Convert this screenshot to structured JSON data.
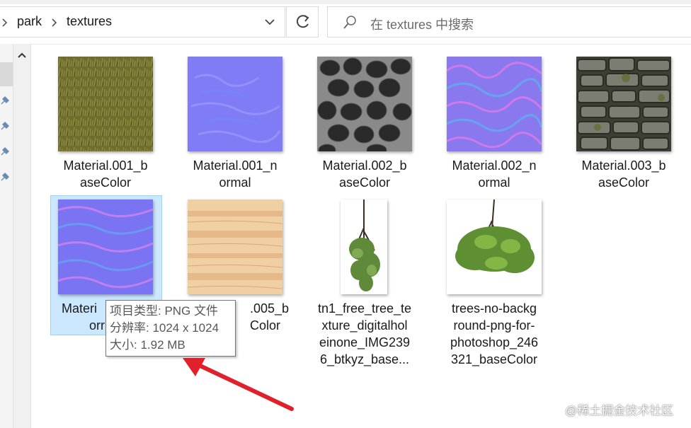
{
  "breadcrumb": [
    "park",
    "textures"
  ],
  "search": {
    "placeholder": "在 textures 中搜索"
  },
  "files": [
    {
      "name": "Material.001_baseColor",
      "lines": [
        "Material.001_b",
        "aseColor"
      ]
    },
    {
      "name": "Material.001_normal",
      "lines": [
        "Material.001_n",
        "ormal"
      ]
    },
    {
      "name": "Material.002_baseColor",
      "lines": [
        "Material.002_b",
        "aseColor"
      ]
    },
    {
      "name": "Material.002_normal",
      "lines": [
        "Material.002_n",
        "ormal"
      ]
    },
    {
      "name": "Material.003_baseColor",
      "lines": [
        "Material.003_b",
        "aseColor"
      ]
    },
    {
      "name": "Material.004_normal",
      "lines": [
        "Materi",
        "orr"
      ]
    },
    {
      "name": "Material.005_baseColor",
      "lines": [
        ".005_b",
        "Color"
      ]
    },
    {
      "name": "tn1_free_tree_texture_digitalholeinone_IMG2396_btkyz_baseColor",
      "lines": [
        "tn1_free_tree_te",
        "xture_digitalhol",
        "einone_IMG239",
        "6_btkyz_base..."
      ]
    },
    {
      "name": "trees-no-background-png-for-photoshop_246321_baseColor",
      "lines": [
        "trees-no-backg",
        "round-png-for-",
        "photoshop_246",
        "321_baseColor"
      ]
    }
  ],
  "tooltip": {
    "type": "项目类型: PNG 文件",
    "resolution": "分辨率: 1024 x 1024",
    "size": "大小: 1.92 MB"
  },
  "watermark": "@稀土掘金技术社区",
  "colors": {
    "selection": "#cce8ff",
    "arrow": "#e0202a"
  },
  "icons": [
    "chevron-right-icon",
    "chevron-down-icon",
    "refresh-icon",
    "search-icon",
    "pin-icon",
    "scroll-up-icon"
  ]
}
